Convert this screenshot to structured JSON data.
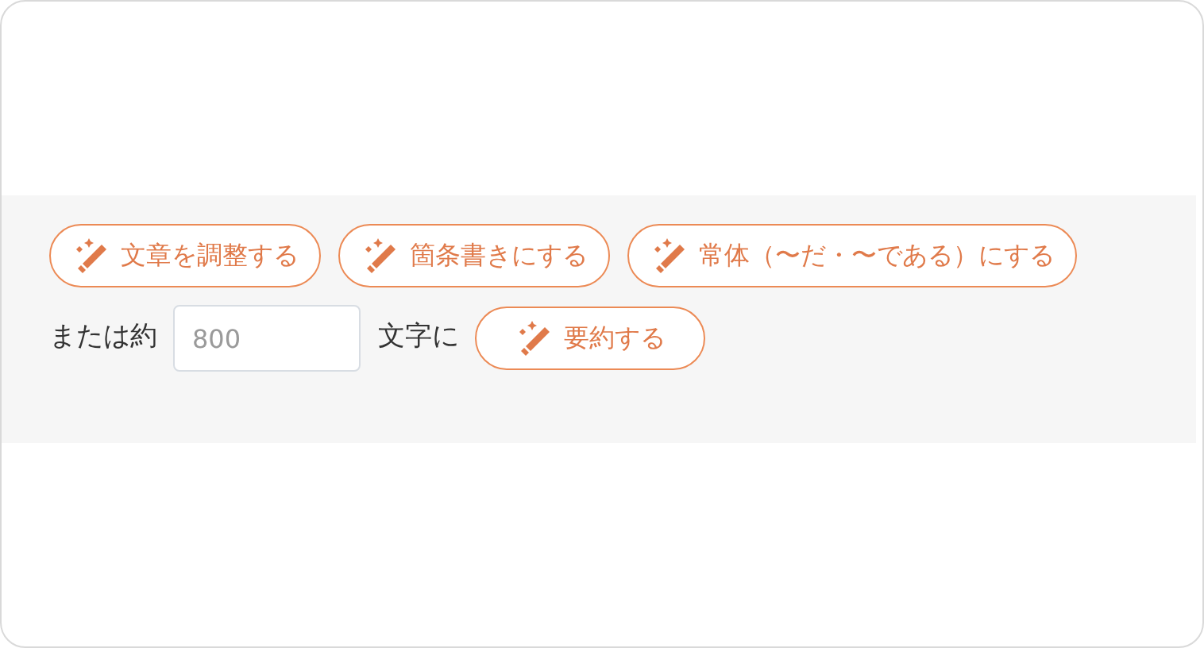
{
  "actions": [
    {
      "label": "文章を調整する"
    },
    {
      "label": "箇条書きにする"
    },
    {
      "label": "常体（〜だ・〜である）にする"
    }
  ],
  "summary": {
    "prefix": "または約",
    "field": {
      "placeholder": "800"
    },
    "suffix": "文字に",
    "button": {
      "label": "要約する"
    }
  }
}
